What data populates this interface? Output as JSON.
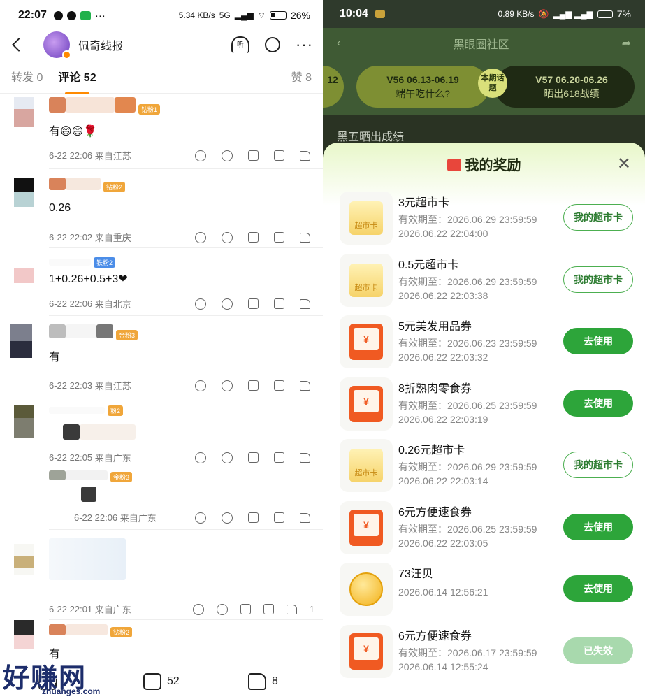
{
  "left": {
    "status": {
      "time": "22:07",
      "net": "5.34 KB/s",
      "signal": "5G",
      "battery": "26%"
    },
    "header": {
      "name": "佩奇线报",
      "listen": "听"
    },
    "tabs": {
      "repost": "转发 0",
      "comments": "评论 52",
      "likes": "赞 8"
    },
    "comments": [
      {
        "text": "有😄😄🌹",
        "rank": "钻粉1",
        "time": "6-22 22:06",
        "loc": "来自江苏"
      },
      {
        "text": "0.26",
        "rank": "钻粉2",
        "time": "6-22 22:02",
        "loc": "来自重庆"
      },
      {
        "text": "1+0.26+0.5+3❤",
        "rank": "铁粉2",
        "time": "6-22 22:06",
        "loc": "来自北京"
      },
      {
        "text": "有",
        "rank": "金粉3",
        "time": "6-22 22:03",
        "loc": "来自江苏"
      },
      {
        "text": "",
        "rank": "粉2",
        "time": "6-22 22:05",
        "loc": "来自广东"
      },
      {
        "text": "",
        "rank": "金粉3",
        "time": "6-22 22:06",
        "loc": "来自广东"
      },
      {
        "text": "",
        "rank": "",
        "time": "6-22 22:01",
        "loc": "来自广东",
        "likes": "1"
      },
      {
        "text": "有",
        "rank": "钻粉2",
        "time": "",
        "loc": ""
      }
    ],
    "bottom": {
      "comments": "52",
      "likes": "8"
    },
    "watermark": "好赚网",
    "watermark_sub": "zhuanges.com"
  },
  "right": {
    "status": {
      "time": "10:04",
      "net": "0.89 KB/s",
      "battery": "7%"
    },
    "header": {
      "title": "黑眼圈社区"
    },
    "topics": [
      {
        "label": "12",
        "sub": ""
      },
      {
        "label": "V56 06.13-06.19",
        "sub": "端午吃什么?"
      },
      {
        "label": "V57 06.20-06.26",
        "sub": "晒出618战绩"
      }
    ],
    "topic_tag": "本期话题",
    "feed_text": "黑五晒出成绩",
    "sheet_title": "我的奖励",
    "rewards": [
      {
        "name": "3元超市卡",
        "expire": "有效期至：2026.06.29 23:59:59",
        "date": "2026.06.22 22:04:00",
        "btn": "我的超市卡",
        "type": "card",
        "btnStyle": "outline"
      },
      {
        "name": "0.5元超市卡",
        "expire": "有效期至：2026.06.29 23:59:59",
        "date": "2026.06.22 22:03:38",
        "btn": "我的超市卡",
        "type": "card",
        "btnStyle": "outline"
      },
      {
        "name": "5元美发用品券",
        "expire": "有效期至：2026.06.23 23:59:59",
        "date": "2026.06.22 22:03:32",
        "btn": "去使用",
        "type": "coupon",
        "btnStyle": "solid"
      },
      {
        "name": "8折熟肉零食券",
        "expire": "有效期至：2026.06.25 23:59:59",
        "date": "2026.06.22 22:03:19",
        "btn": "去使用",
        "type": "coupon",
        "btnStyle": "solid"
      },
      {
        "name": "0.26元超市卡",
        "expire": "有效期至：2026.06.29 23:59:59",
        "date": "2026.06.22 22:03:14",
        "btn": "我的超市卡",
        "type": "card",
        "btnStyle": "outline"
      },
      {
        "name": "6元方便速食券",
        "expire": "有效期至：2026.06.25 23:59:59",
        "date": "2026.06.22 22:03:05",
        "btn": "去使用",
        "type": "coupon",
        "btnStyle": "solid"
      },
      {
        "name": "73汪贝",
        "expire": "",
        "date": "2026.06.14 12:56:21",
        "btn": "去使用",
        "type": "coin",
        "btnStyle": "solid"
      },
      {
        "name": "6元方便速食券",
        "expire": "有效期至：2026.06.17 23:59:59",
        "date": "2026.06.14 12:55:24",
        "btn": "已失效",
        "type": "coupon",
        "btnStyle": "expired"
      }
    ],
    "card_label": "超市卡",
    "coupon_symbol": "¥"
  }
}
